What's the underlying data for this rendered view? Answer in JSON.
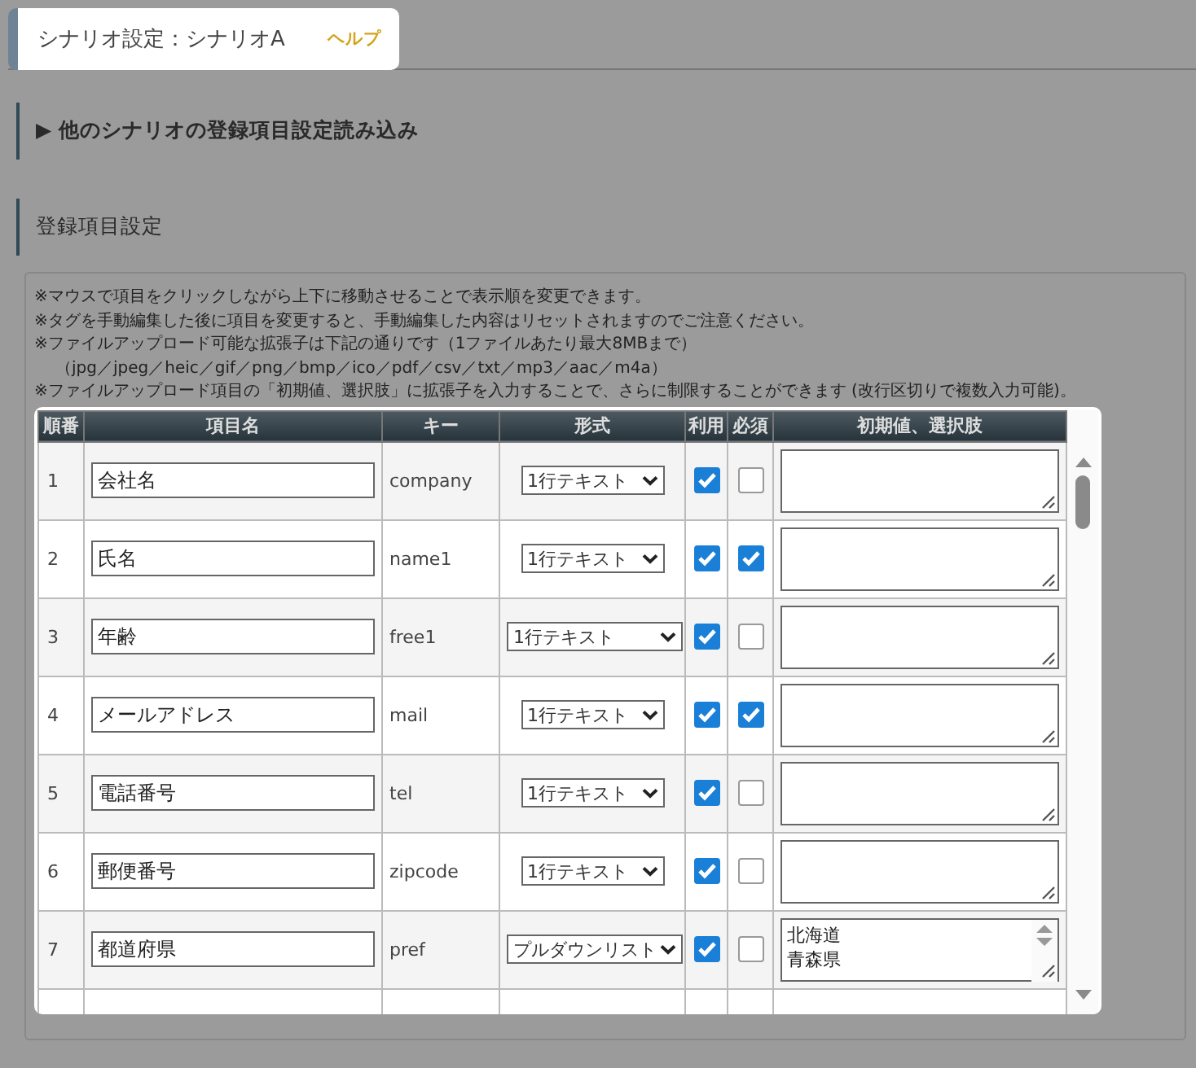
{
  "page_title": "シナリオ設定：シナリオA",
  "help_link": "ヘルプ",
  "sections": [
    {
      "label": "▶ 他のシナリオの登録項目設定読み込み",
      "kind": "toggle"
    },
    {
      "label": "登録項目設定",
      "kind": "heading"
    }
  ],
  "notes": [
    "※マウスで項目をクリックしながら上下に移動させることで表示順を変更できます。",
    "※タグを手動編集した後に項目を変更すると、手動編集した内容はリセットされますのでご注意ください。",
    "※ファイルアップロード可能な拡張子は下記の通りです（1ファイルあたり最大8MBまで）",
    "（jpg／jpeg／heic／gif／png／bmp／ico／pdf／csv／txt／mp3／aac／m4a）",
    "※ファイルアップロード項目の「初期値、選択肢」に拡張子を入力することで、さらに制限することができます (改行区切りで複数入力可能)。"
  ],
  "table": {
    "columns": [
      "順番",
      "項目名",
      "キー",
      "形式",
      "利用",
      "必須",
      "初期値、選択肢"
    ],
    "rows": [
      {
        "order": "1",
        "name": "会社名",
        "key": "company",
        "format": "1行テキスト",
        "format_wide": false,
        "use": true,
        "required": false,
        "scrollable": false
      },
      {
        "order": "2",
        "name": "氏名",
        "key": "name1",
        "format": "1行テキスト",
        "format_wide": false,
        "use": true,
        "required": true,
        "scrollable": false
      },
      {
        "order": "3",
        "name": "年齢",
        "key": "free1",
        "format": "1行テキスト",
        "format_wide": true,
        "use": true,
        "required": false,
        "scrollable": false
      },
      {
        "order": "4",
        "name": "メールアドレス",
        "key": "mail",
        "format": "1行テキスト",
        "format_wide": false,
        "use": true,
        "required": true,
        "scrollable": false
      },
      {
        "order": "5",
        "name": "電話番号",
        "key": "tel",
        "format": "1行テキスト",
        "format_wide": false,
        "use": true,
        "required": false,
        "scrollable": false
      },
      {
        "order": "6",
        "name": "郵便番号",
        "key": "zipcode",
        "format": "1行テキスト",
        "format_wide": false,
        "use": true,
        "required": false,
        "scrollable": false
      },
      {
        "order": "7",
        "name": "都道府県",
        "key": "pref",
        "format": "プルダウンリスト",
        "format_wide": true,
        "use": true,
        "required": false,
        "initial": [
          "北海道",
          "青森県"
        ],
        "scrollable": true
      }
    ]
  }
}
